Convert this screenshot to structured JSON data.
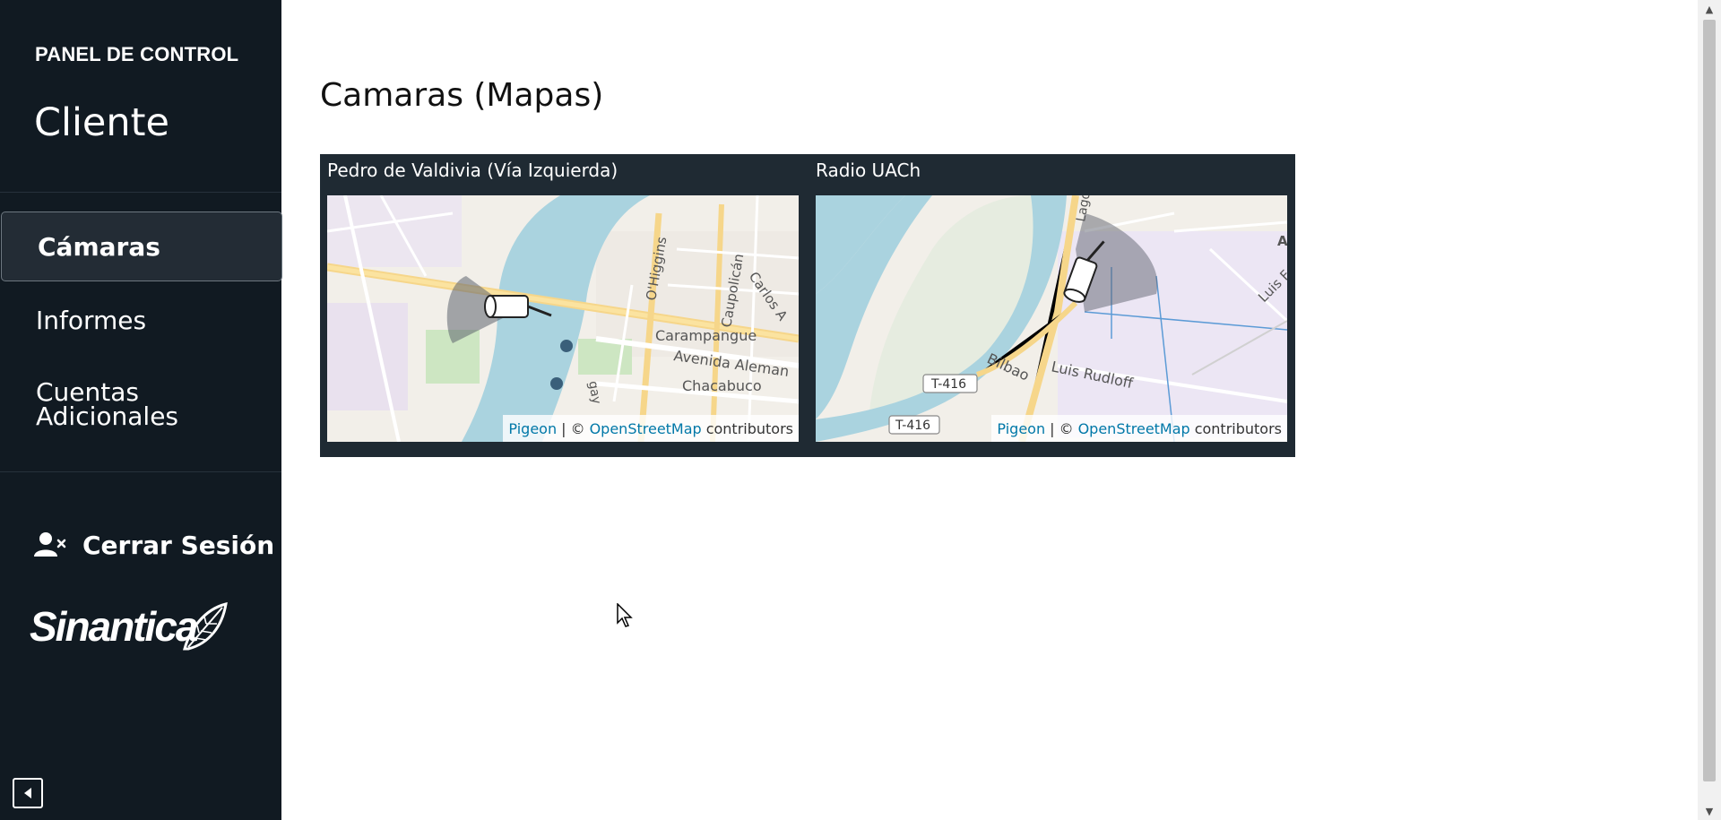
{
  "sidebar": {
    "panel_title": "PANEL DE CONTROL",
    "client_title": "Cliente",
    "nav": [
      {
        "label": "Cámaras",
        "active": true
      },
      {
        "label": "Informes",
        "active": false
      },
      {
        "label": "Cuentas Adicionales",
        "active": false
      }
    ],
    "logout_label": "Cerrar Sesión",
    "brand": "Sinantica"
  },
  "main": {
    "title": "Camaras (Mapas)",
    "cameras": [
      {
        "name": "Pedro de Valdivia (Vía Izquierda)",
        "labels": [
          "O'Higgins",
          "Caupolicán",
          "Carlos A",
          "Carampangue",
          "Avenida Aleman",
          "Chacabuco",
          "gay"
        ]
      },
      {
        "name": "Radio UACh",
        "labels": [
          "Lagos",
          "A",
          "Luis F",
          "Bilbao",
          "Luis Rudloff",
          "T-416",
          "T-416"
        ]
      }
    ],
    "attribution": {
      "pigeon": "Pigeon",
      "separator": "| ©",
      "osm": "OpenStreetMap",
      "contributors": "contributors"
    }
  },
  "colors": {
    "sidebar_bg": "#111a22",
    "map_frame_bg": "#1f2a33",
    "water": "#aad3df",
    "link": "#0078a8"
  }
}
